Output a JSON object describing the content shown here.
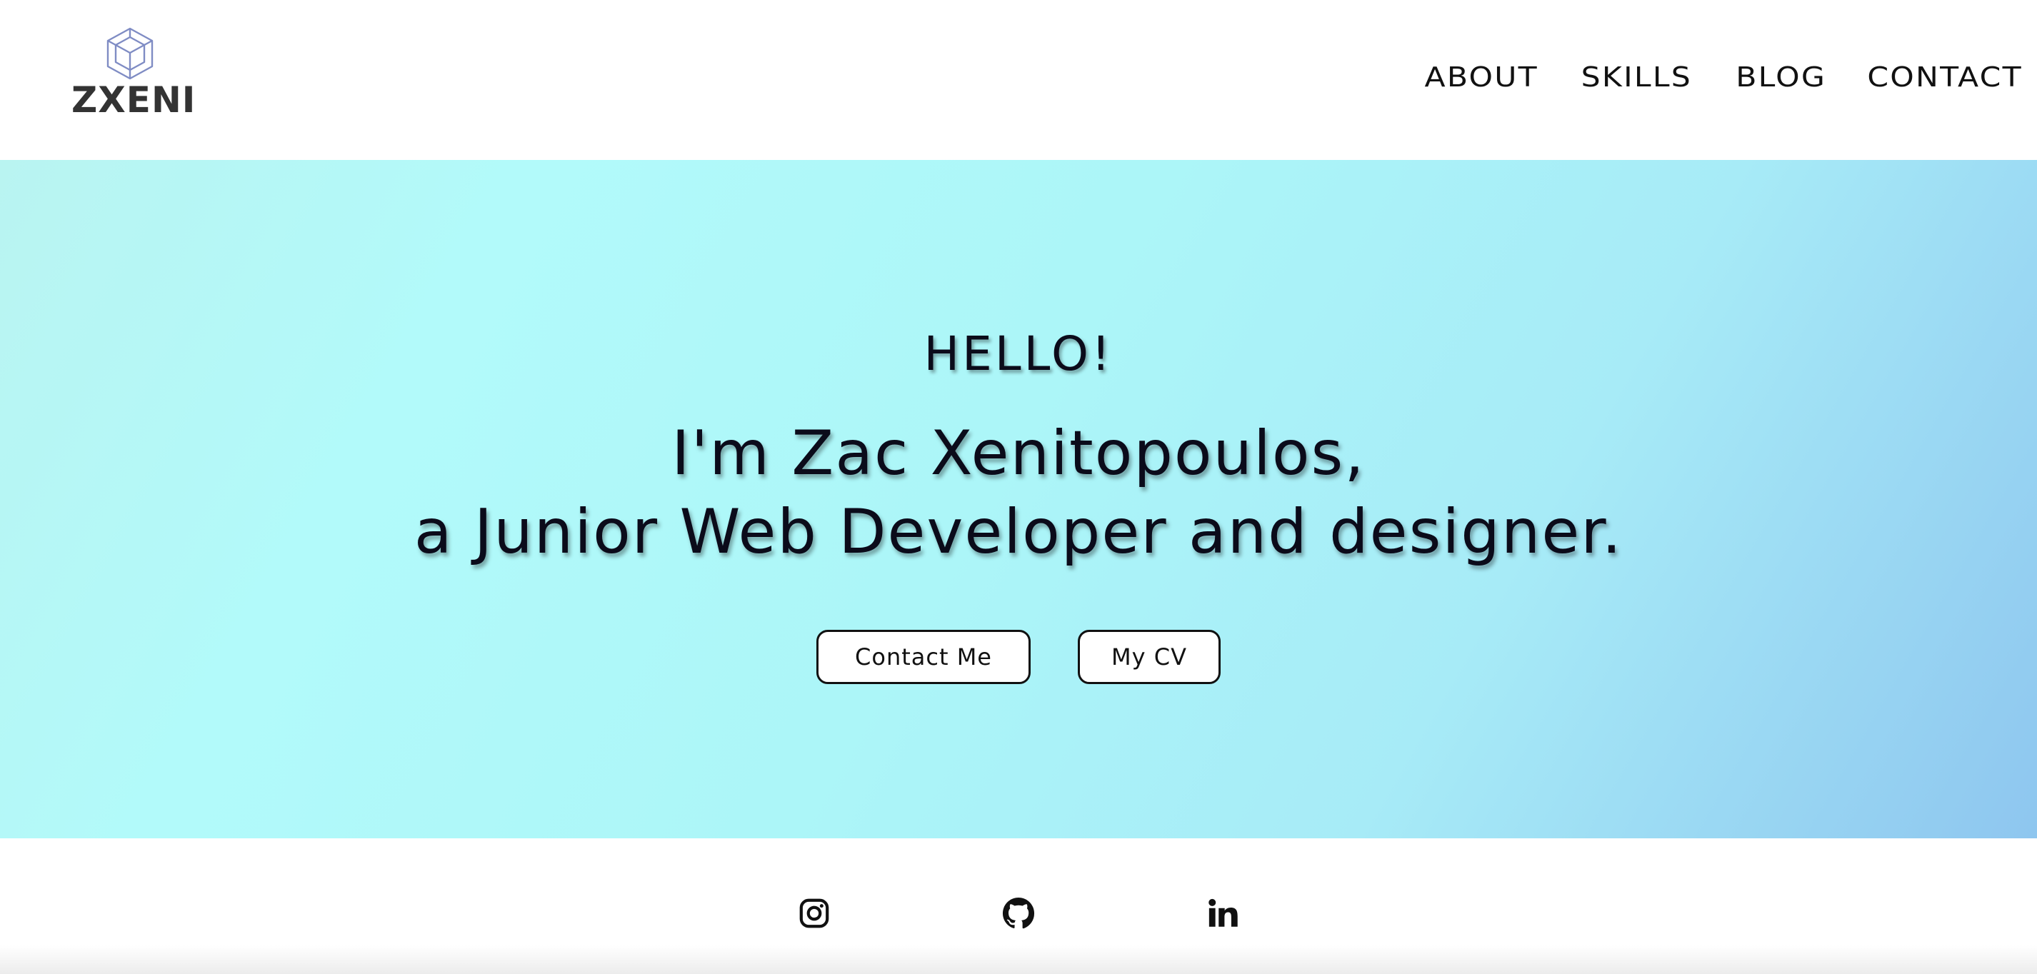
{
  "brand": {
    "logo_icon": "cube-icon",
    "name": "ZXENI",
    "logo_color": "#7f8cc4"
  },
  "nav": {
    "items": [
      {
        "label": "ABOUT"
      },
      {
        "label": "SKILLS"
      },
      {
        "label": "BLOG"
      },
      {
        "label": "CONTACT"
      }
    ]
  },
  "hero": {
    "greeting": "HELLO!",
    "title_line1": "I'm Zac Xenitopoulos,",
    "title_line2": "a Junior Web Developer and designer.",
    "buttons": {
      "contact": "Contact Me",
      "cv": "My CV"
    },
    "gradient_colors": [
      "#b9f4f1",
      "#b2fafa",
      "#a7ebf7",
      "#8ec6ef"
    ]
  },
  "social": {
    "icons": [
      "instagram-icon",
      "github-icon",
      "linkedin-icon"
    ]
  }
}
